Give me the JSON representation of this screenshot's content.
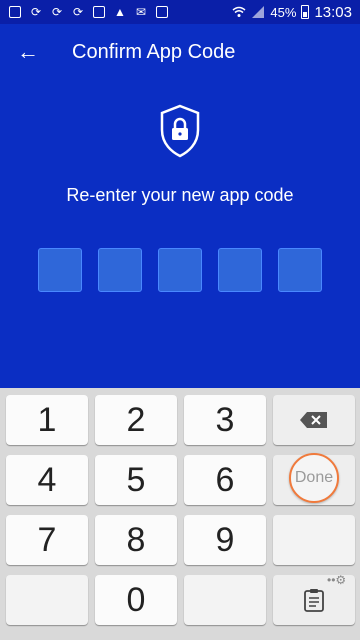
{
  "status_bar": {
    "left_icons": [
      "plus-box-icon",
      "sync-icon",
      "sync-icon",
      "sync-icon",
      "image-icon",
      "warning-icon",
      "email-icon",
      "gmail-icon"
    ],
    "battery_percent": "45%",
    "time": "13:03"
  },
  "header": {
    "title": "Confirm App Code",
    "back_icon": "arrow-left-icon"
  },
  "main": {
    "shield_icon": "shield-lock-icon",
    "prompt": "Re-enter your new app code",
    "code_length": 5
  },
  "keyboard": {
    "keys": [
      "1",
      "2",
      "3",
      "4",
      "5",
      "6",
      "7",
      "8",
      "9",
      "0"
    ],
    "done_label": "Done",
    "backspace_icon": "backspace-icon",
    "clipboard_icon": "clipboard-icon"
  },
  "colors": {
    "background": "#0b2ec3",
    "status_bar": "#0a1fa8",
    "code_box": "#2f67d9",
    "keyboard": "#d9d9d9",
    "done_ring": "#f07a3c"
  }
}
